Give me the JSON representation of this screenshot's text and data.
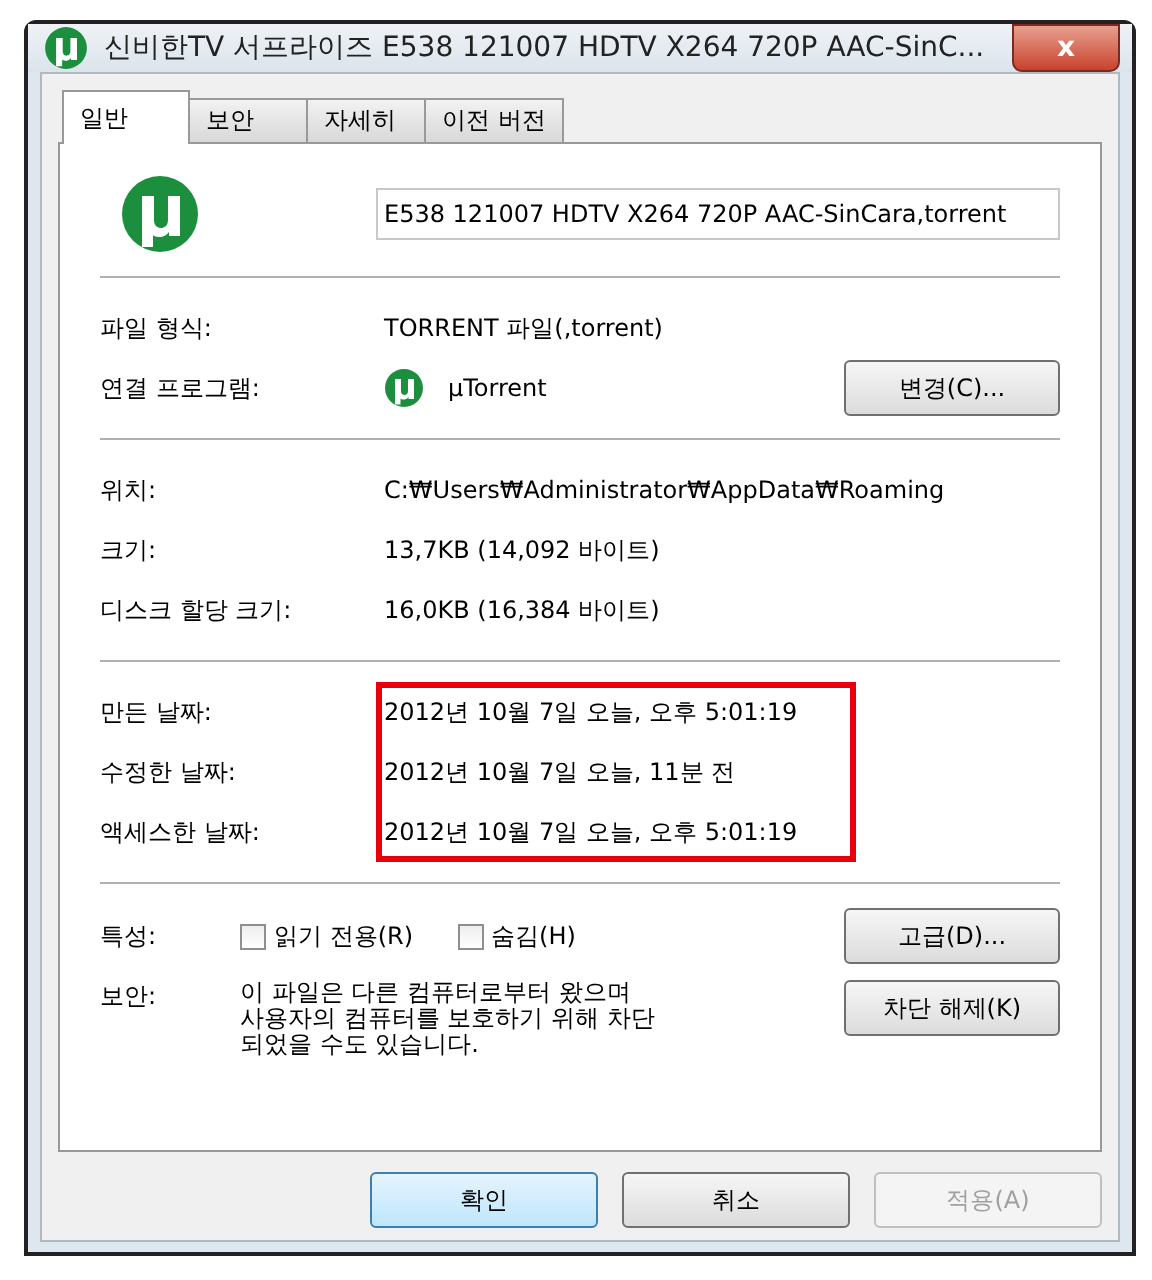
{
  "window": {
    "title": "신비한TV 서프라이즈 E538 121007 HDTV X264 720P AAC-SinC...",
    "close": "x"
  },
  "tabs": [
    {
      "label": "일반",
      "selected": true
    },
    {
      "label": "보안",
      "selected": false
    },
    {
      "label": "자세히",
      "selected": false
    },
    {
      "label": "이전 버전",
      "selected": false
    }
  ],
  "file_name": {
    "value": "E538 121007 HDTV X264 720P AAC-SinCara,torrent"
  },
  "type_section": [
    {
      "label": "파일 형식:",
      "value": "TORRENT 파일(,torrent)"
    },
    {
      "label": "연결 프로그램:",
      "value": "µTorrent",
      "button": "변경(C)..."
    }
  ],
  "location_section": [
    {
      "label": "위치:",
      "value": "C:₩Users₩Administrator₩AppData₩Roaming"
    },
    {
      "label": "크기:",
      "value": "13,7KB (14,092 바이트)"
    },
    {
      "label": "디스크 할당 크기:",
      "value": "16,0KB (16,384 바이트)"
    }
  ],
  "dates": {
    "highlighted": true,
    "items": [
      {
        "label": "만든 날짜:",
        "value": "2012년 10월 7일 오늘, 오후 5:01:19"
      },
      {
        "label": "수정한 날짜:",
        "value": "2012년 10월 7일 오늘, 11분 전"
      },
      {
        "label": "액세스한 날짜:",
        "value": "2012년 10월 7일 오늘, 오후 5:01:19"
      }
    ]
  },
  "attributes": {
    "label": "특성:",
    "checkboxes": [
      {
        "label": "읽기 전용(R)",
        "checked": false
      },
      {
        "label": "숨김(H)",
        "checked": false
      }
    ],
    "button": "고급(D)..."
  },
  "security": {
    "label": "보안:",
    "text": "이 파일은 다른 컴퓨터로부터 왔으며\n사용자의 컴퓨터를 보호하기 위해 차단\n되었을 수도 있습니다.",
    "button": "차단 해제(K)"
  },
  "buttons": [
    {
      "label": "확인",
      "default": true,
      "disabled": false
    },
    {
      "label": "취소",
      "default": false,
      "disabled": false
    },
    {
      "label": "적용(A)",
      "default": false,
      "disabled": true
    }
  ]
}
